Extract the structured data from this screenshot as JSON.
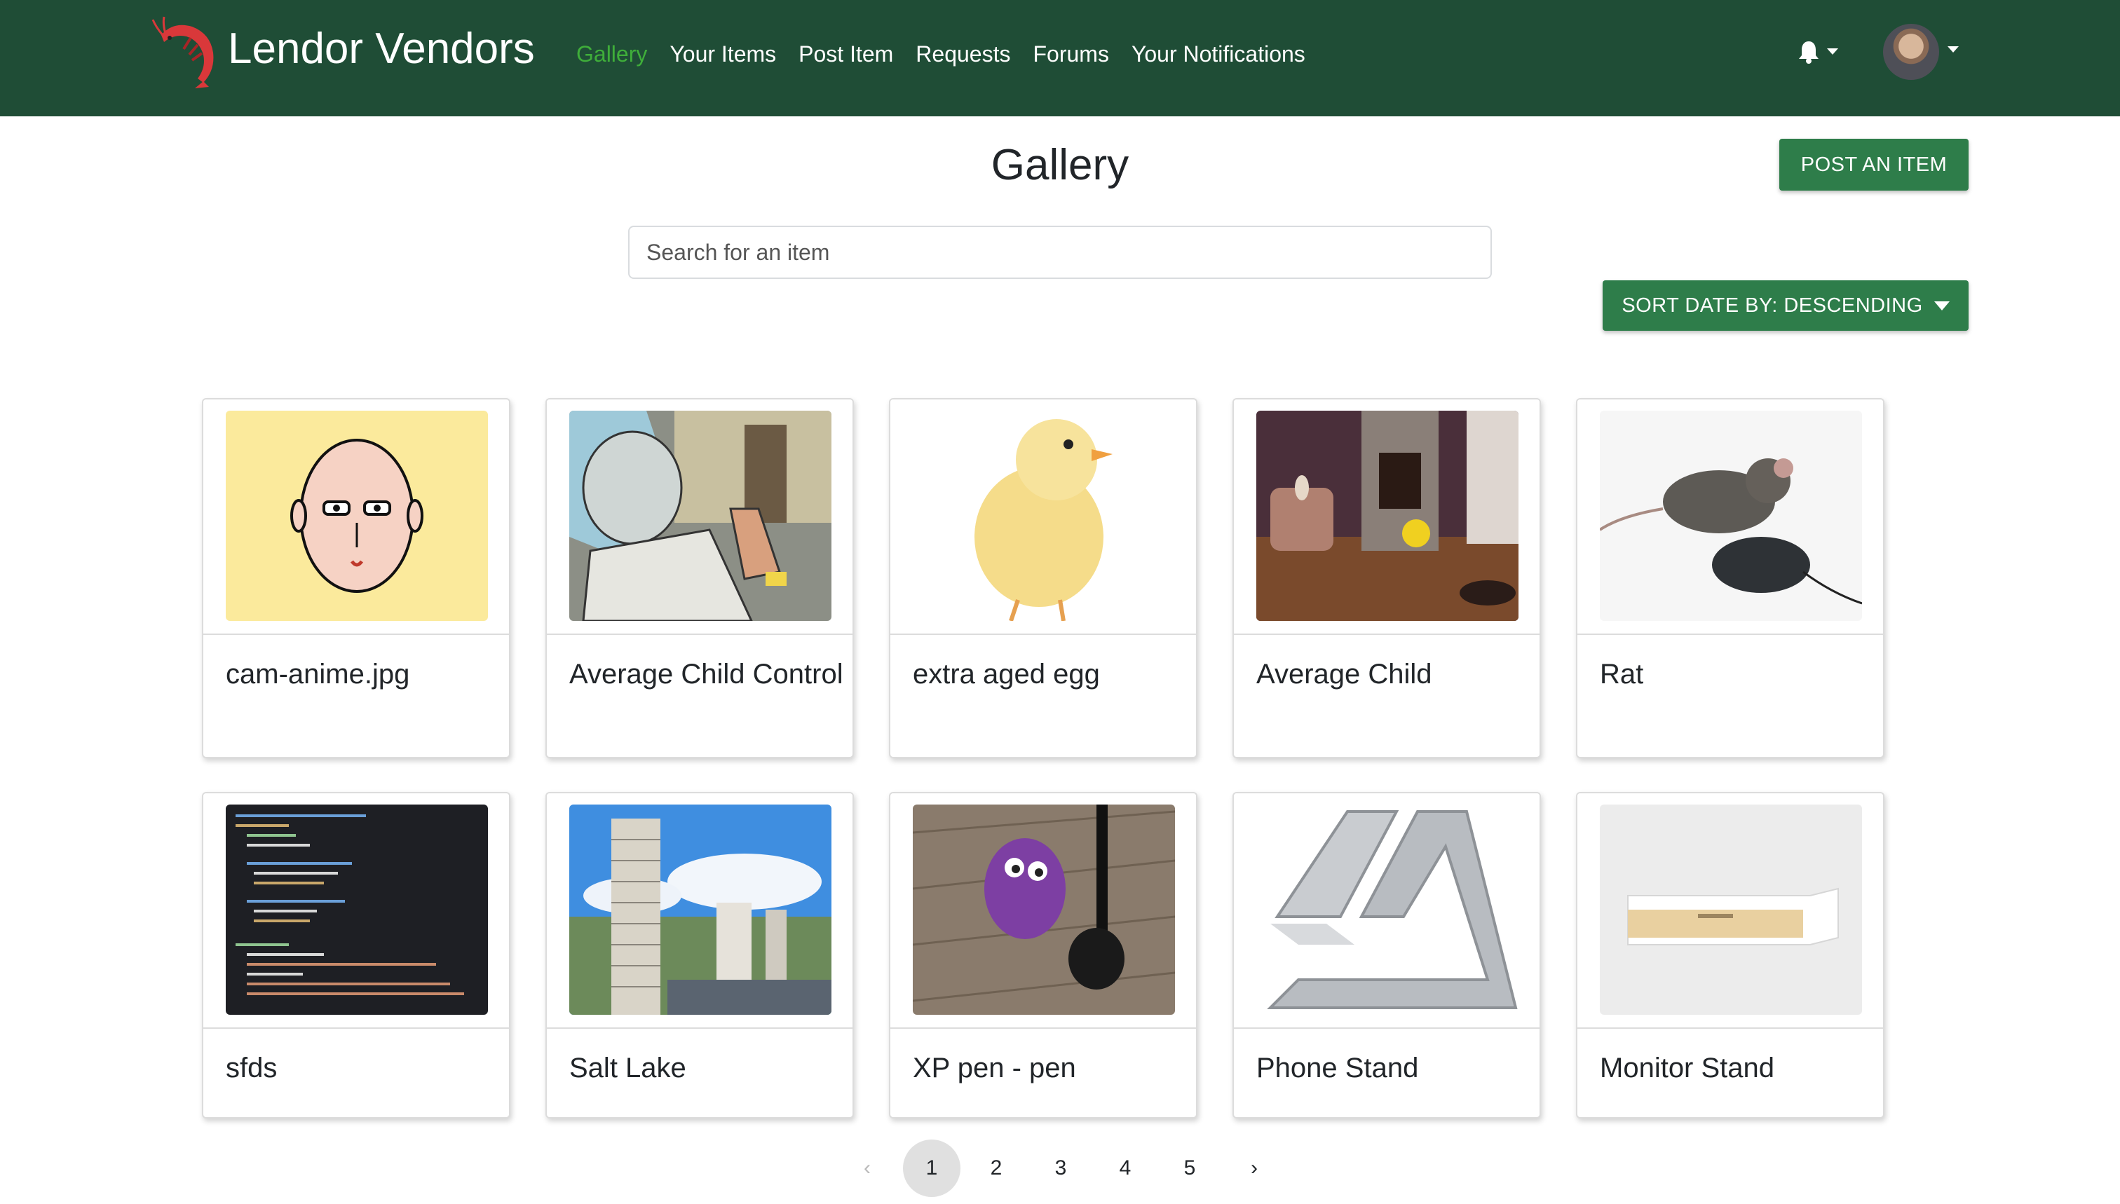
{
  "navbar": {
    "brand": "Lendor Vendors",
    "links": [
      "Gallery",
      "Your Items",
      "Post Item",
      "Requests",
      "Forums",
      "Your Notifications"
    ],
    "active_link": "Gallery",
    "icons": [
      "shrimp-logo-icon",
      "bell-icon",
      "user-avatar"
    ]
  },
  "page": {
    "title": "Gallery",
    "post_button": "POST AN ITEM",
    "search_placeholder": "Search for an item",
    "sort_button": "SORT DATE BY: DESCENDING"
  },
  "items": [
    {
      "title": "cam-anime.jpg",
      "image": "bald anime face"
    },
    {
      "title": "Average Child Control",
      "image": "cartoon scientist"
    },
    {
      "title": "extra aged egg",
      "image": "yellow chick"
    },
    {
      "title": "Average Child",
      "image": "living room scene"
    },
    {
      "title": "Rat",
      "image": "rat on computer mouse"
    },
    {
      "title": "sfds",
      "image": "code editor screenshot"
    },
    {
      "title": "Salt Lake",
      "image": "city high-rise buildings"
    },
    {
      "title": "XP pen - pen",
      "image": "purple toy figure and pen"
    },
    {
      "title": "Phone Stand",
      "image": "aluminum phone stand"
    },
    {
      "title": "Monitor Stand",
      "image": "white monitor stand with drawer"
    }
  ],
  "pagination": {
    "prev": "‹",
    "pages": [
      "1",
      "2",
      "3",
      "4",
      "5"
    ],
    "current": "1",
    "next": "›"
  },
  "colors": {
    "navbar": "#1f4d36",
    "active_link": "#3fae3a",
    "button": "#2e7d4a"
  }
}
